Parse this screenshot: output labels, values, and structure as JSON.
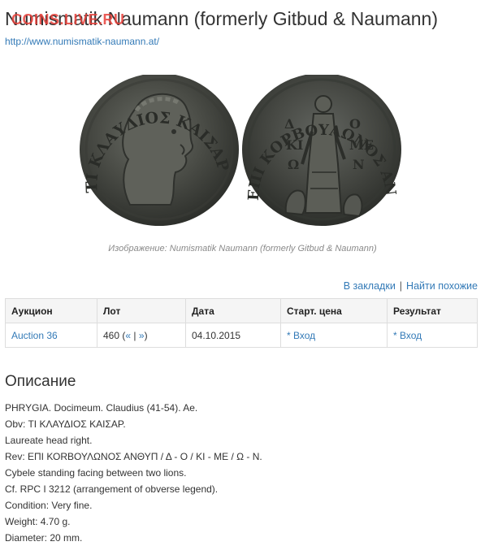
{
  "header": {
    "title": "Numismatik Naumann (formerly Gitbud & Naumann)",
    "watermark": "COINS.LIVE.RU",
    "site_url": "http://www.numismatik-naumann.at/"
  },
  "image": {
    "caption": "Изображение: Numismatik Naumann (formerly Gitbud & Naumann)",
    "obverse_legend": "ΤΙ ΚΛΑΥΔΙΟΣ ΚΑΙΣΑΡ",
    "reverse_legend": "ΕΠΙ ΚΟΡΒΟΥΛΩΝΟΣ ΑΝΘΥΠ",
    "coin_color": "#4a4c46"
  },
  "actions": {
    "bookmark": "В закладки",
    "separator": "|",
    "find_similar": "Найти похожие"
  },
  "table": {
    "headers": [
      "Аукцион",
      "Лот",
      "Дата",
      "Старт. цена",
      "Результат"
    ],
    "row": {
      "auction": "Auction 36",
      "lot": "460",
      "lot_open": "(",
      "prev": "«",
      "bar": "|",
      "next": "»",
      "lot_close": ")",
      "date": "04.10.2015",
      "start_price": "* Вход",
      "result": "* Вход"
    }
  },
  "description": {
    "heading": "Описание",
    "lines": [
      "PHRYGIA. Docimeum. Claudius (41-54). Ae.",
      "Obv: TI ΚΛΑΥΔΙΟΣ ΚΑΙΣΑΡ.",
      "Laureate head right.",
      "Rev: ΕΠΙ ΚΟRΒΟΥΛΩΝΟΣ ΑΝΘΥΠ / Δ - Ο / ΚΙ - ΜΕ / Ω - Ν.",
      "Cybele standing facing between two lions.",
      "Cf. RPC I 3212 (arrangement of obverse legend).",
      "Condition: Very fine.",
      "Weight: 4.70 g.",
      "Diameter: 20 mm."
    ]
  },
  "colors": {
    "link": "#337ab7",
    "watermark": "#e8403a",
    "table_header_bg": "#f5f5f5"
  }
}
